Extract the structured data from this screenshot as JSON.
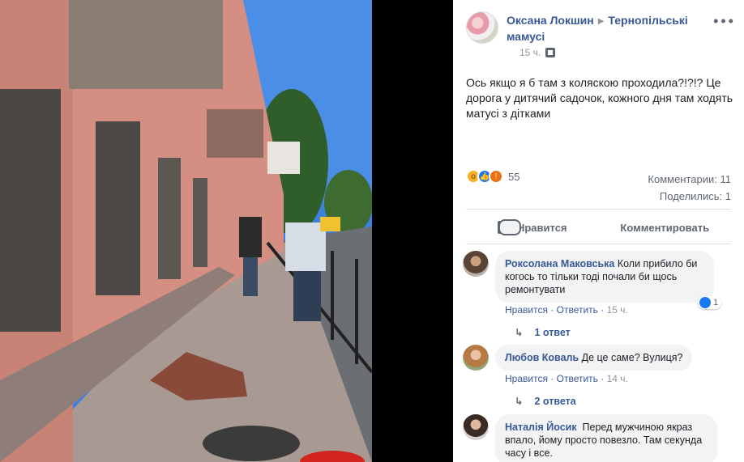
{
  "post": {
    "author": "Оксана Локшин",
    "group": "Тернопільські мамусі",
    "time": "15 ч.",
    "text": "Ось якщо я б там з коляскою проходила?!?!? Це дорога у дитячий садочок, кожного дня там ходять матусі з дітками",
    "reactions_count": "55",
    "comments_label": "Комментарии: 11",
    "shares_label": "Поделились: 1"
  },
  "actions": {
    "like": "Нравится",
    "comment": "Комментировать"
  },
  "comments": [
    {
      "author": "Роксолана Маковська",
      "text": "Коли прибило би когось то тільки тоді почали би щось ремонтувати",
      "like": "Нравится",
      "reply": "Ответить",
      "time": "15 ч.",
      "reactions": "1",
      "replies": "1 ответ"
    },
    {
      "author": "Любов Коваль",
      "text": "Де це саме? Вулиця?",
      "like": "Нравится",
      "reply": "Ответить",
      "time": "14 ч.",
      "replies": "2 ответа"
    },
    {
      "author": "Наталія Йосик",
      "text": "Перед мужчиною якраз впало, йому просто повезло. Там секунда часу і все."
    }
  ],
  "colors": {
    "link": "#385898",
    "meta": "#90949c",
    "bubble": "#f2f3f5",
    "like_blue": "#1877f2"
  },
  "icons": [
    "more-icon",
    "globe-icon",
    "wow-reaction-icon",
    "like-reaction-icon",
    "angry-reaction-icon",
    "thumb-up-icon",
    "comment-bubble-icon",
    "reply-arrow-icon"
  ]
}
